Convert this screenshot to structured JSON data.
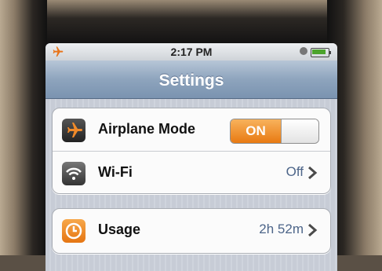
{
  "status_bar": {
    "time": "2:17 PM",
    "icons": [
      "airplane-icon",
      "lock-icon",
      "battery-icon"
    ]
  },
  "nav": {
    "title": "Settings"
  },
  "groups": [
    {
      "rows": [
        {
          "label": "Airplane Mode",
          "icon": "airplane-icon",
          "toggle": "ON"
        },
        {
          "label": "Wi-Fi",
          "icon": "wifi-icon",
          "value": "Off"
        }
      ]
    },
    {
      "rows": [
        {
          "label": "Usage",
          "icon": "clock-icon",
          "value": "2h 52m"
        }
      ]
    }
  ],
  "colors": {
    "accent_orange": "#e87a12",
    "nav_blue": "#7a93b0",
    "value_blue": "#4d6589"
  }
}
